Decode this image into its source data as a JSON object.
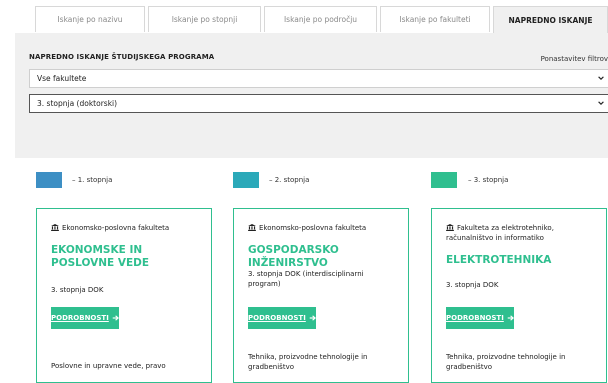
{
  "tabs": [
    {
      "label": "Iskanje po nazivu",
      "active": false
    },
    {
      "label": "Iskanje po stopnji",
      "active": false
    },
    {
      "label": "Iskanje po področju",
      "active": false
    },
    {
      "label": "Iskanje po fakulteti",
      "active": false
    },
    {
      "label": "NAPREDNO ISKANJE",
      "active": true
    }
  ],
  "panel": {
    "title": "NAPREDNO ISKANJE ŠTUDIJSKEGA PROGRAMA",
    "reset_label": "Ponastavitev filtrov",
    "faculty_select": "Vse fakultete",
    "level_select": "3. stopnja (doktorski)"
  },
  "legend": [
    {
      "label": "– 1. stopnja",
      "color": "#3d8fc4"
    },
    {
      "label": "– 2. stopnja",
      "color": "#2ba9b9"
    },
    {
      "label": "– 3. stopnja",
      "color": "#2fbf8f"
    }
  ],
  "cards": [
    {
      "faculty": "Ekonomsko-poslovna fakulteta",
      "program": "EKONOMSKE IN POSLOVNE VEDE",
      "level": "3. stopnja DOK",
      "button": "PODROBNOSTI",
      "area": "Poslovne in upravne vede, pravo"
    },
    {
      "faculty": "Ekonomsko-poslovna fakulteta",
      "program": "GOSPODARSKO INŽENIRSTVO",
      "level": "3. stopnja DOK (interdisciplinarni program)",
      "button": "PODROBNOSTI",
      "area": "Tehnika, proizvodne tehnologije in gradbeništvo"
    },
    {
      "faculty": "Fakulteta za elektrotehniko, računalništvo in informatiko",
      "program": "ELEKTROTEHNIKA",
      "level": "3. stopnja DOK",
      "button": "PODROBNOSTI",
      "area": "Tehnika, proizvodne tehnologije in gradbeništvo"
    }
  ]
}
